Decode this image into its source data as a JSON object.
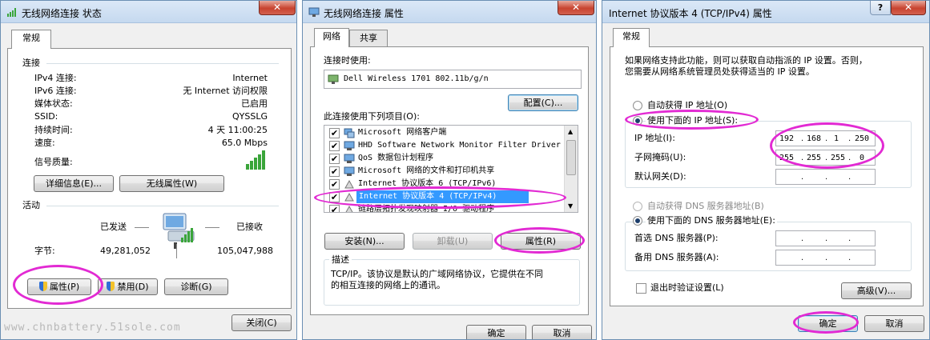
{
  "status_window": {
    "title": "无线网络连接 状态",
    "close_glyph": "✕",
    "tab_general": "常规",
    "section_connection": "连接",
    "rows": [
      {
        "label": "IPv4 连接:",
        "value": "Internet"
      },
      {
        "label": "IPv6 连接:",
        "value": "无 Internet 访问权限"
      },
      {
        "label": "媒体状态:",
        "value": "已启用"
      },
      {
        "label": "SSID:",
        "value": "QYSSLG"
      },
      {
        "label": "持续时间:",
        "value": "4 天 11:00:25"
      },
      {
        "label": "速度:",
        "value": "65.0 Mbps"
      }
    ],
    "signal_label": "信号质量:",
    "signal_bars_lit": 5,
    "details_button": "详细信息(E)...",
    "wireless_props_button": "无线属性(W)",
    "section_activity": "活动",
    "sent_label": "已发送",
    "received_label": "已接收",
    "bytes_label": "字节:",
    "bytes_sent": "49,281,052",
    "bytes_received": "105,047,988",
    "properties_button": "属性(P)",
    "disable_button": "禁用(D)",
    "diagnose_button": "诊断(G)",
    "close_button": "关闭(C)",
    "watermark": "www.chnbattery.51sole.com"
  },
  "props_window": {
    "title": "无线网络连接 属性",
    "close_glyph": "✕",
    "tab_network": "网络",
    "tab_sharing": "共享",
    "connect_using_label": "连接时使用:",
    "adapter_name": "Dell Wireless 1701 802.11b/g/n",
    "configure_button": "配置(C)...",
    "items_label": "此连接使用下列项目(O):",
    "items": [
      {
        "label": "Microsoft 网络客户端",
        "checked": "✔",
        "icon": "network-client-icon"
      },
      {
        "label": "HHD Software Network Monitor Filter Driver",
        "checked": "✔",
        "icon": "filter-driver-icon"
      },
      {
        "label": "QoS 数据包计划程序",
        "checked": "✔",
        "icon": "qos-icon"
      },
      {
        "label": "Microsoft 网络的文件和打印机共享",
        "checked": "✔",
        "icon": "file-share-icon"
      },
      {
        "label": "Internet 协议版本 6 (TCP/IPv6)",
        "checked": "✔",
        "icon": "protocol-icon"
      },
      {
        "label": "Internet 协议版本 4 (TCP/IPv4)",
        "checked": "✔",
        "icon": "protocol-icon"
      },
      {
        "label": "链路层拓扑发现映射器 I/O 驱动程序",
        "checked": "✔",
        "icon": "protocol-icon"
      }
    ],
    "install_button": "安装(N)...",
    "uninstall_button": "卸载(U)",
    "properties_button": "属性(R)",
    "description_title": "描述",
    "description_text_1": "TCP/IP。该协议是默认的广域网络协议，它提供在不同",
    "description_text_2": "的相互连接的网络上的通讯。",
    "ok_button": "确定",
    "cancel_button": "取消"
  },
  "ipv4_window": {
    "title": "Internet 协议版本 4 (TCP/IPv4) 属性",
    "help_glyph": "?",
    "close_glyph": "✕",
    "tab_general": "常规",
    "intro_1": "如果网络支持此功能，则可以获取自动指派的 IP 设置。否则，",
    "intro_2": "您需要从网络系统管理员处获得适当的 IP 设置。",
    "auto_ip_label": "自动获得 IP 地址(O)",
    "manual_ip_label": "使用下面的 IP 地址(S):",
    "ip_label": "IP 地址(I):",
    "ip_octets": [
      "192",
      "168",
      "1",
      "250"
    ],
    "mask_label": "子网掩码(U):",
    "mask_octets": [
      "255",
      "255",
      "255",
      "0"
    ],
    "gateway_label": "默认网关(D):",
    "auto_dns_label": "自动获得 DNS 服务器地址(B)",
    "manual_dns_label": "使用下面的 DNS 服务器地址(E):",
    "preferred_dns_label": "首选 DNS 服务器(P):",
    "alternate_dns_label": "备用 DNS 服务器(A):",
    "validate_label": "退出时验证设置(L)",
    "advanced_button": "高级(V)...",
    "ok_button": "确定",
    "cancel_button": "取消"
  },
  "colors": {
    "highlight_ellipse": "#e22ad3",
    "selection": "#3399ff",
    "signal": "#3aa53a"
  }
}
